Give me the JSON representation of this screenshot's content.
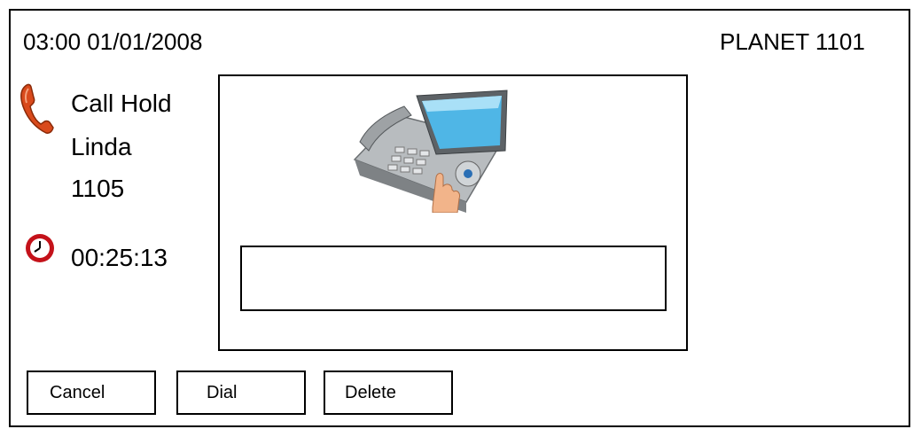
{
  "header": {
    "datetime": "03:00 01/01/2008",
    "device_name": "PLANET 1101"
  },
  "call": {
    "status": "Call Hold",
    "contact_name": "Linda",
    "extension": "1105",
    "duration": "00:25:13",
    "icon": "phone-handset-icon"
  },
  "timer_icon": "clock-icon",
  "illustration_icon": "ip-phone-illustration",
  "input": {
    "value": ""
  },
  "softkeys": {
    "cancel": "Cancel",
    "dial": "Dial",
    "delete": "Delete"
  },
  "colors": {
    "handset": "#d94a1c",
    "clock_ring": "#c4121a",
    "screen": "#4fb6e6"
  }
}
